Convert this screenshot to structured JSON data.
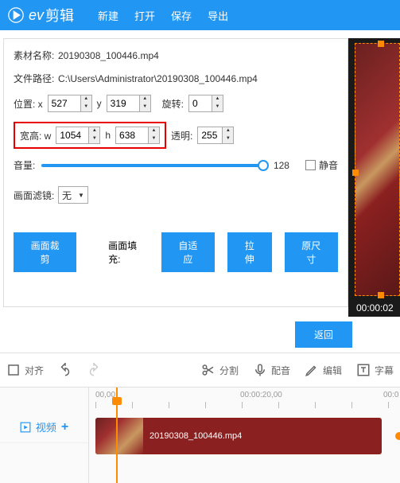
{
  "header": {
    "logo_text": "剪辑",
    "menu": {
      "new": "新建",
      "open": "打开",
      "save": "保存",
      "export": "导出"
    }
  },
  "props": {
    "name_label": "素材名称:",
    "name_value": "20190308_100446.mp4",
    "path_label": "文件路径:",
    "path_value": "C:\\Users\\Administrator\\20190308_100446.mp4",
    "pos_label": "位置: x",
    "pos_x": "527",
    "pos_y_label": "y",
    "pos_y": "319",
    "rotate_label": "旋转:",
    "rotate": "0",
    "size_label": "宽高: w",
    "size_w": "1054",
    "size_h_label": "h",
    "size_h": "638",
    "opacity_label": "透明:",
    "opacity": "255",
    "volume_label": "音量:",
    "volume_value": "128",
    "mute_label": "静音",
    "filter_label": "画面滤镜:",
    "filter_value": "无",
    "crop_btn": "画面裁剪",
    "fill_label": "画面填充:",
    "fill_fit": "自适应",
    "fill_stretch": "拉伸",
    "fill_orig": "原尺寸"
  },
  "preview": {
    "time": "00:00:02"
  },
  "return_btn": "返回",
  "toolbar": {
    "align": "对齐",
    "cut": "分割",
    "dub": "配音",
    "edit": "编辑",
    "text": "字幕"
  },
  "timeline": {
    "track_label": "视频",
    "ruler": [
      "00,00",
      "00:00:20,00",
      "00:0"
    ],
    "clip_name": "20190308_100446.mp4"
  }
}
